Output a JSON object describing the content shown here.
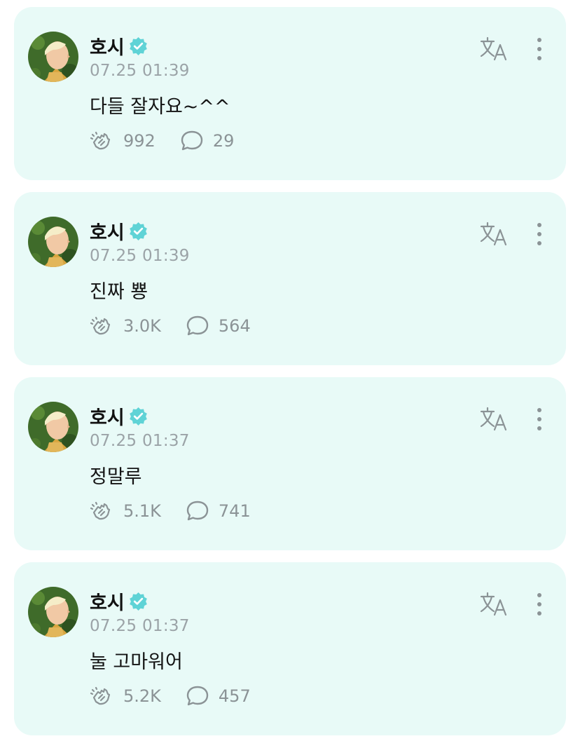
{
  "colors": {
    "card_background": "#e8faf7",
    "verified_badge": "#5fd3d6",
    "timestamp": "#9ba3a7",
    "icon_gray": "#8b9396"
  },
  "icons": {
    "verified": "verified-badge-icon",
    "like": "hands-clap-icon",
    "comment": "speech-bubble-icon",
    "translate": "translate-icon",
    "more": "vertical-ellipsis-icon"
  },
  "posts": [
    {
      "author": "호시",
      "time": "07.25 01:39",
      "text": "다들 잘자요~^^",
      "likes": "992",
      "comments": "29"
    },
    {
      "author": "호시",
      "time": "07.25 01:39",
      "text": "진짜 뿅",
      "likes": "3.0K",
      "comments": "564"
    },
    {
      "author": "호시",
      "time": "07.25 01:37",
      "text": "정말루",
      "likes": "5.1K",
      "comments": "741"
    },
    {
      "author": "호시",
      "time": "07.25 01:37",
      "text": "눌 고마워어",
      "likes": "5.2K",
      "comments": "457"
    }
  ]
}
